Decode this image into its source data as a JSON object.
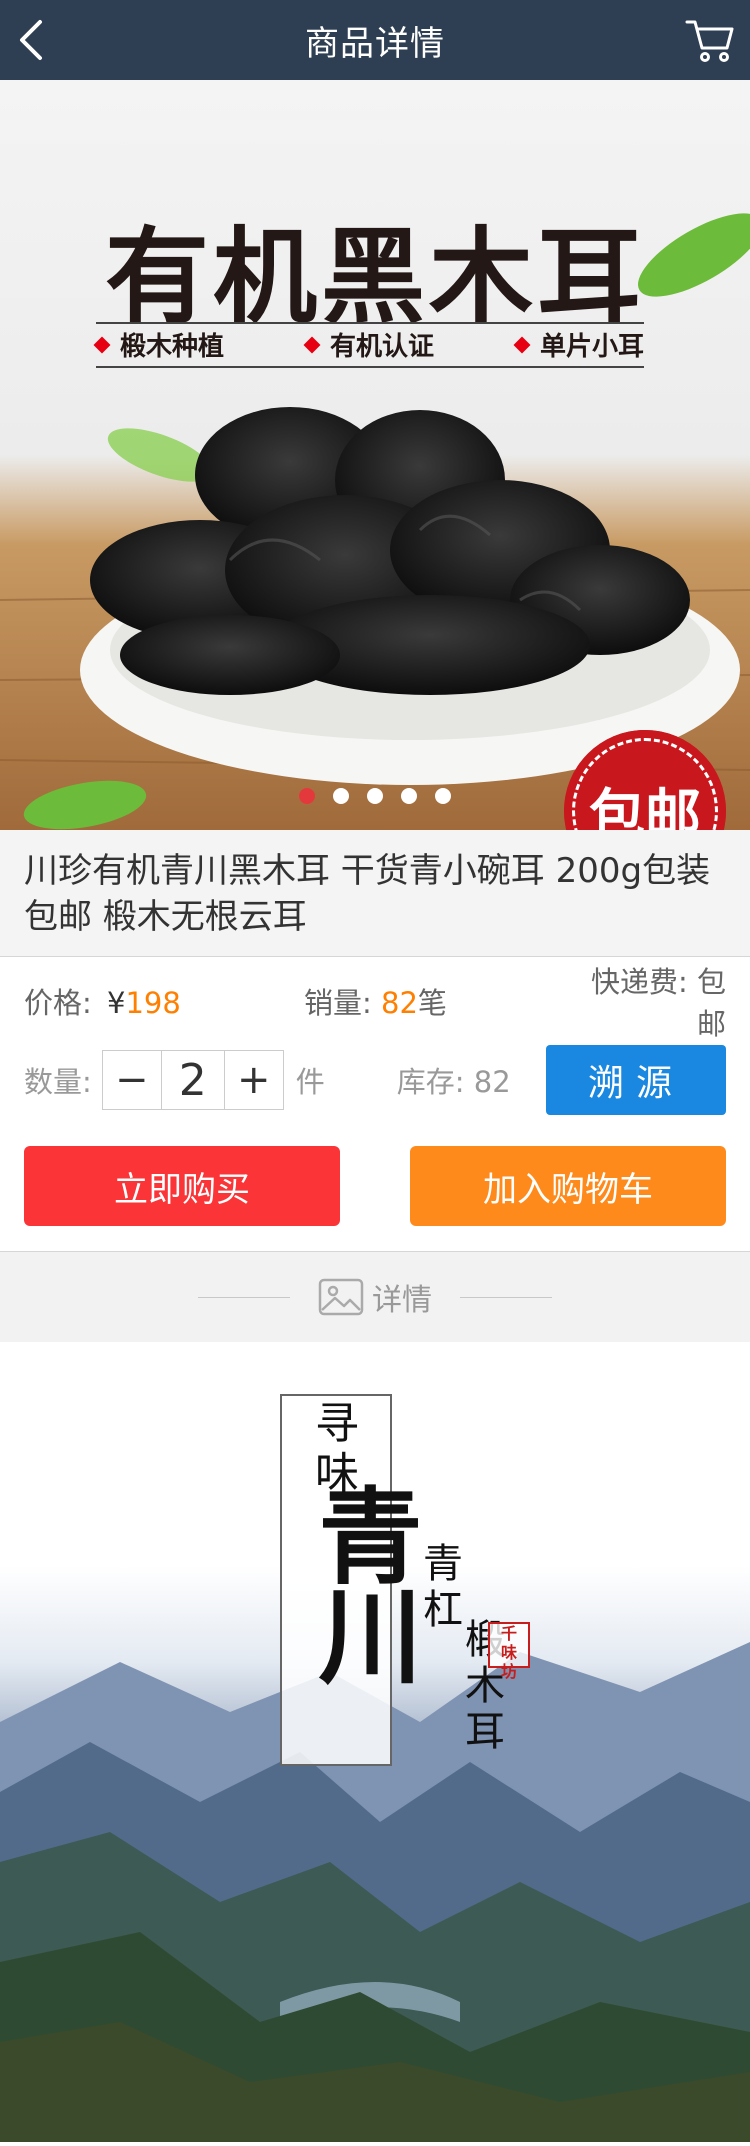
{
  "nav": {
    "title": "商品详情",
    "back_icon": "chevron-left-icon",
    "cart_icon": "shopping-cart-icon"
  },
  "banner": {
    "headline": "有机黑木耳",
    "tags": [
      "椴木种植",
      "有机认证",
      "单片小耳"
    ],
    "badge": "包邮",
    "slide_count": 5,
    "active_slide": 1
  },
  "product": {
    "title": "川珍有机青川黑木耳 干货青小碗耳 200g包装包邮 椴木无根云耳"
  },
  "info": {
    "price_label": "价格:",
    "currency": "¥",
    "price": "198",
    "sales_label": "销量:",
    "sales": "82",
    "sales_unit": "笔",
    "shipping_label": "快递费:",
    "shipping": "包邮"
  },
  "quantity": {
    "label": "数量:",
    "minus": "−",
    "value": "2",
    "plus": "+",
    "unit": "件",
    "stock_label": "库存:",
    "stock": "82",
    "trace_button": "溯源"
  },
  "actions": {
    "buy_now": "立即购买",
    "add_to_cart": "加入购物车"
  },
  "detail": {
    "label": "详情",
    "icon": "image-icon"
  },
  "poster": {
    "line1": "寻味",
    "line2": "青川",
    "line3": "青杠",
    "line4": "椴木耳",
    "seal": "千味坊"
  },
  "colors": {
    "nav_bg": "#2e3e53",
    "accent_orange": "#ff7f00",
    "buy_red": "#fa3437",
    "cart_orange": "#ff8a1c",
    "trace_blue": "#1a87e0"
  }
}
